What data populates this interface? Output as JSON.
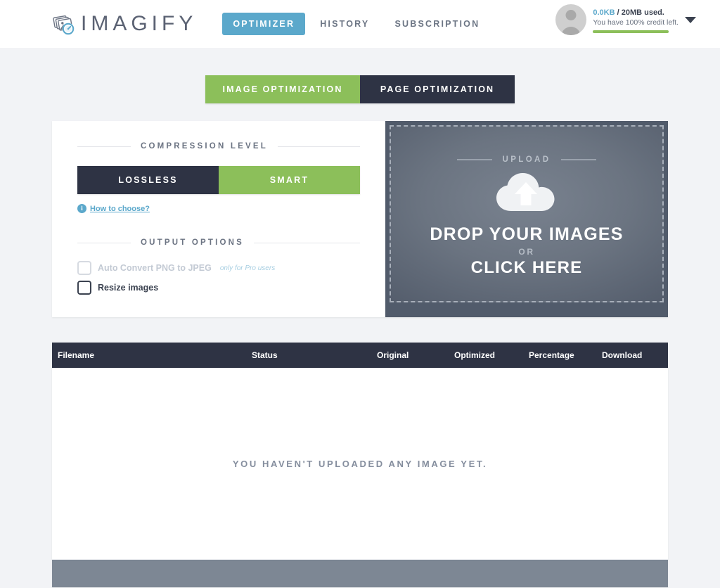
{
  "header": {
    "brand_name": "IMAGIFY",
    "brand_icon": "imagify-logo-icon",
    "nav": [
      {
        "label": "OPTIMIZER",
        "active": true
      },
      {
        "label": "HISTORY",
        "active": false
      },
      {
        "label": "SUBSCRIPTION",
        "active": false
      }
    ],
    "account": {
      "avatar_icon": "user-avatar-icon",
      "used": "0.0KB",
      "quota": "/ 20MB used.",
      "credit_left": "You have 100% credit left.",
      "credit_percent": 100,
      "credit_bar_color": "#8cbf5a",
      "caret_icon": "chevron-down-icon"
    }
  },
  "mode_tabs": [
    {
      "label": "IMAGE OPTIMIZATION",
      "active": true,
      "color": "#8cbf5a"
    },
    {
      "label": "PAGE OPTIMIZATION",
      "active": false,
      "color": "#2e3344"
    }
  ],
  "settings": {
    "compression": {
      "title": "COMPRESSION LEVEL",
      "options": [
        {
          "label": "LOSSLESS",
          "selected": false,
          "color": "#2e3344"
        },
        {
          "label": "SMART",
          "selected": true,
          "color": "#8cbf5a"
        }
      ],
      "help_icon": "info-icon",
      "help_glyph": "i",
      "help_label": "How to choose?"
    },
    "output": {
      "title": "OUTPUT OPTIONS",
      "items": [
        {
          "label": "Auto Convert PNG to JPEG",
          "note": "only for Pro users",
          "checked": false,
          "disabled": true
        },
        {
          "label": "Resize images",
          "note": "",
          "checked": false,
          "disabled": false
        }
      ]
    }
  },
  "upload": {
    "heading": "UPLOAD",
    "icon": "cloud-upload-icon",
    "main_text": "DROP YOUR IMAGES",
    "or_text": "OR",
    "sub_text": "CLICK HERE"
  },
  "results": {
    "columns": [
      "Filename",
      "Status",
      "Original",
      "Optimized",
      "Percentage",
      "Download"
    ],
    "rows": [],
    "empty_message": "YOU HAVEN'T UPLOADED ANY IMAGE YET."
  },
  "colors": {
    "accent_blue": "#5ba8cb",
    "accent_green": "#8cbf5a",
    "navy": "#2e3344",
    "page_bg": "#f2f3f6",
    "footer_bar": "#7d8794"
  }
}
